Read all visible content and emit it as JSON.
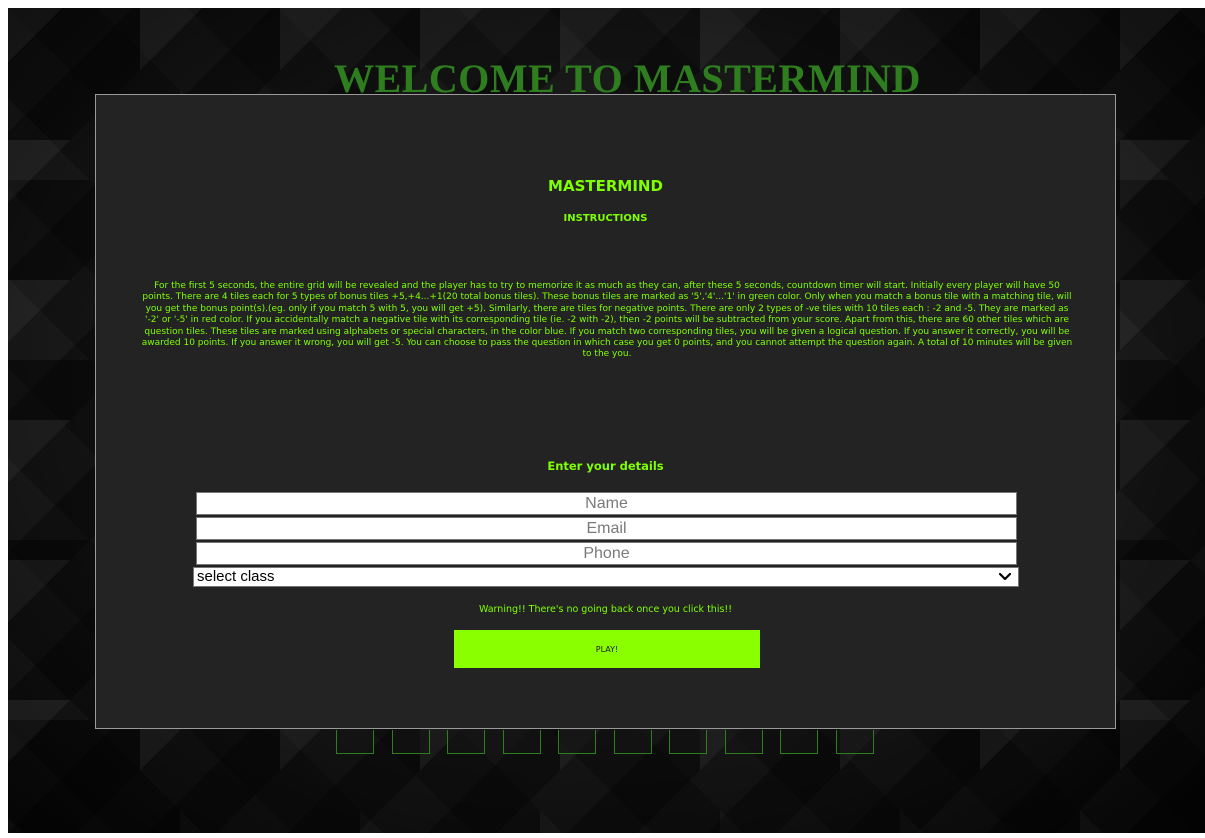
{
  "page": {
    "title": "WELCOME TO MASTERMIND"
  },
  "panel": {
    "heading": "MASTERMIND",
    "subheading": "INSTRUCTIONS",
    "instructions": "For the first 5 seconds, the entire grid will be revealed and the player has to try to memorize it as much as they can, after these 5 seconds, countdown timer will start. Initially every player will have 50 points. There are 4 tiles each for 5 types of bonus tiles +5,+4...+1(20 total bonus tiles). These bonus tiles are marked as '5','4'...'1' in green color. Only when you match a bonus tile with a matching tile, will you get the bonus point(s).(eg. only if you match 5 with 5, you will get +5). Similarly, there are tiles for negative points. There are only 2 types of -ve tiles with 10 tiles each : -2 and -5. They are marked as '-2' or '-5' in red color. If you accidentally match a negative tile with its corresponding tile (ie. -2 with -2), then -2 points will be subtracted from your score. Apart from this, there are 60 other tiles which are question tiles. These tiles are marked using alphabets or special characters, in the color blue. If you match two corresponding tiles, you will be given a logical question. If you answer it correctly, you will be awarded 10 points. If you answer it wrong, you will get -5. You can choose to pass the question in which case you get 0 points, and you cannot attempt the question again. A total of 10 minutes will be given to the you.",
    "details_heading": "Enter your details"
  },
  "form": {
    "name_placeholder": "Name",
    "email_placeholder": "Email",
    "phone_placeholder": "Phone",
    "class_selected": "select class",
    "warning": "Warning!! There's no going back once you click this!!",
    "play_label": "PLAY!"
  },
  "colors": {
    "accent": "#7fff00",
    "title_green": "#2e7d1e",
    "play_button": "#8aff00",
    "panel_bg": "#232323"
  },
  "icons": {
    "select_chevron": "chevron-down-icon"
  },
  "tiles_count": 10
}
